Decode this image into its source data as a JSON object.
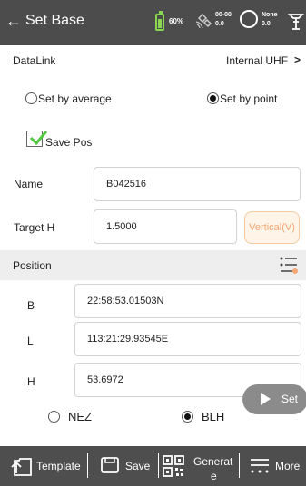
{
  "header": {
    "title": "Set Base",
    "battery_text": "60%",
    "satellite_top": "00-00",
    "satellite_bottom": "0.0",
    "solution_top": "None",
    "solution_bottom": "0.0"
  },
  "datalink": {
    "label": "DataLink",
    "value": "Internal UHF",
    "chevron": ">"
  },
  "mode": {
    "average_label": "Set by average",
    "point_label": "Set by point",
    "selected": "point"
  },
  "save_pos": {
    "label": "Save Pos",
    "checked": true
  },
  "name": {
    "label": "Name",
    "value": "B042516"
  },
  "target_h": {
    "label": "Target H",
    "value": "1.5000",
    "button_label": "Vertical(V)"
  },
  "position": {
    "label": "Position"
  },
  "coords": {
    "b_label": "B",
    "b_value": "22:58:53.01503N",
    "l_label": "L",
    "l_value": "113:21:29.93545E",
    "h_label": "H",
    "h_value": "53.6972"
  },
  "coord_type": {
    "nez_label": "NEZ",
    "blh_label": "BLH",
    "selected": "BLH"
  },
  "set_button": {
    "label": "Set"
  },
  "bottom_bar": {
    "template_label": "Template",
    "save_label": "Save",
    "generate_label_line1": "Generat",
    "generate_label_line2": "e",
    "more_label": "More"
  },
  "colors": {
    "header_bg": "#4c4c4c",
    "battery": "#8ad84f",
    "checkbox_check": "#54c842",
    "vertical_button": "#f3a774",
    "bottom_bar_bg": "#4e4e4e"
  },
  "icons": [
    "back-arrow-icon",
    "battery-icon",
    "satellite-icon",
    "solution-circle-icon",
    "device-icon",
    "checkbox-check-icon",
    "list-settings-icon",
    "play-icon",
    "template-icon",
    "save-icon",
    "qr-code-icon",
    "more-icon"
  ]
}
